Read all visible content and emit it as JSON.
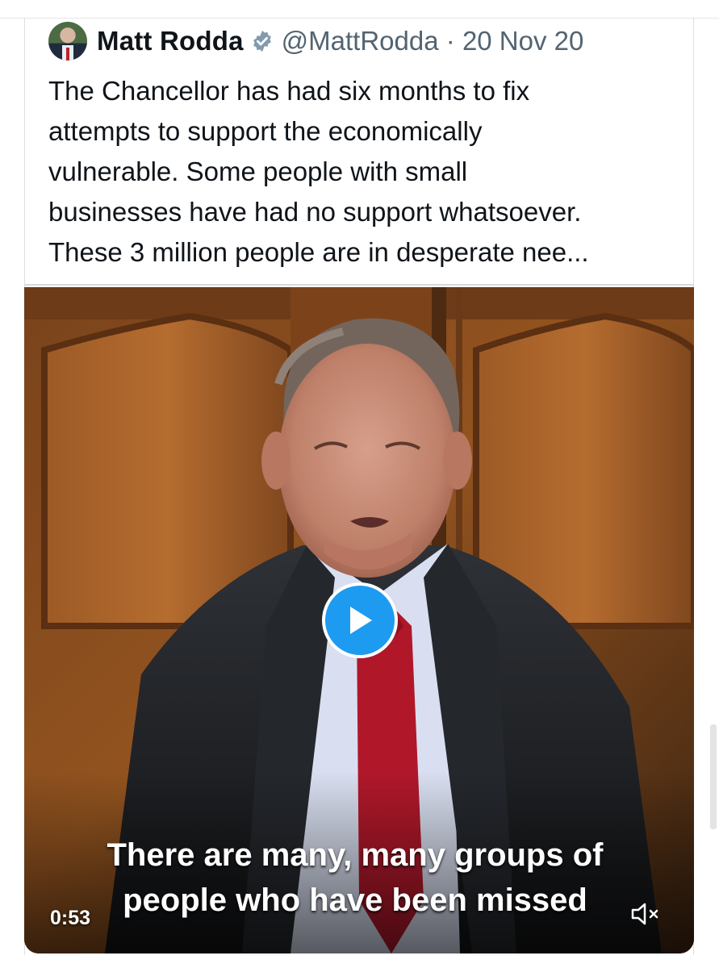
{
  "post": {
    "author_name": "Matt Rodda",
    "author_handle": "@MattRodda",
    "separator": "·",
    "date": "20 Nov 20",
    "text_lines": [
      "The Chancellor has had six months to fix",
      "attempts to support the economically",
      "vulnerable. Some people with small",
      "businesses have had no support whatsoever.",
      "These 3 million people are in desperate nee..."
    ]
  },
  "video": {
    "subtitle_line1": "There are many, many groups of",
    "subtitle_line2": "people who have been missed",
    "duration": "0:53",
    "play_icon": "play-icon",
    "mute_icon": "muted-speaker-icon"
  },
  "colors": {
    "accent": "#1d9bf0",
    "text": "#0f1419",
    "secondary_text": "#536471"
  }
}
